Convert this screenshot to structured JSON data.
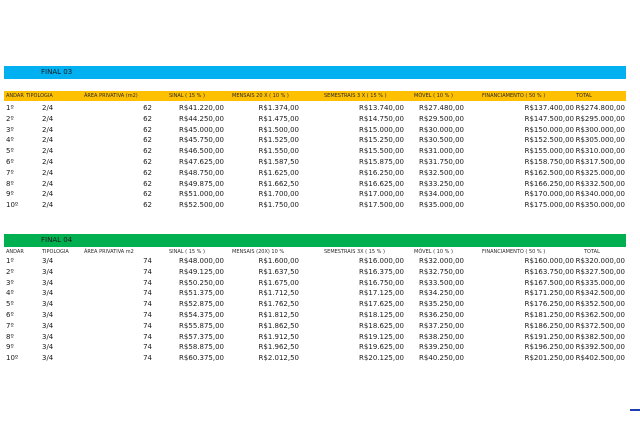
{
  "colors": {
    "band1": "#00b0f0",
    "header1": "#ffc000",
    "band2": "#00b050",
    "header2": "#ffffff",
    "accent": "#1f3fb0"
  },
  "sections": [
    {
      "title": "FINAL 03",
      "headers": [
        "ANDAR",
        "TIPOLOGIA",
        "ÁREA PRIVATIVA (m2)",
        "SINAL ( 15 % )",
        "MENSAIS 20 X ( 10 % )",
        "SEMESTRAIS 3 X ( 15 % )",
        "MÓVEL ( 10 % )",
        "FINANCIAMENTO ( 50 % )",
        "TOTAL"
      ],
      "rows": [
        [
          "1º",
          "2/4",
          "62",
          "R$41.220,00",
          "R$1.374,00",
          "R$13.740,00",
          "R$27.480,00",
          "R$137.400,00",
          "R$274.800,00"
        ],
        [
          "2º",
          "2/4",
          "62",
          "R$44.250,00",
          "R$1.475,00",
          "R$14.750,00",
          "R$29.500,00",
          "R$147.500,00",
          "R$295.000,00"
        ],
        [
          "3º",
          "2/4",
          "62",
          "R$45.000,00",
          "R$1.500,00",
          "R$15.000,00",
          "R$30.000,00",
          "R$150.000,00",
          "R$300.000,00"
        ],
        [
          "4º",
          "2/4",
          "62",
          "R$45.750,00",
          "R$1.525,00",
          "R$15.250,00",
          "R$30.500,00",
          "R$152.500,00",
          "R$305.000,00"
        ],
        [
          "5º",
          "2/4",
          "62",
          "R$46.500,00",
          "R$1.550,00",
          "R$15.500,00",
          "R$31.000,00",
          "R$155.000,00",
          "R$310.000,00"
        ],
        [
          "6º",
          "2/4",
          "62",
          "R$47.625,00",
          "R$1.587,50",
          "R$15.875,00",
          "R$31.750,00",
          "R$158.750,00",
          "R$317.500,00"
        ],
        [
          "7º",
          "2/4",
          "62",
          "R$48.750,00",
          "R$1.625,00",
          "R$16.250,00",
          "R$32.500,00",
          "R$162.500,00",
          "R$325.000,00"
        ],
        [
          "8º",
          "2/4",
          "62",
          "R$49.875,00",
          "R$1.662,50",
          "R$16.625,00",
          "R$33.250,00",
          "R$166.250,00",
          "R$332.500,00"
        ],
        [
          "9º",
          "2/4",
          "62",
          "R$51.000,00",
          "R$1.700,00",
          "R$17.000,00",
          "R$34.000,00",
          "R$170.000,00",
          "R$340.000,00"
        ],
        [
          "10º",
          "2/4",
          "62",
          "R$52.500,00",
          "R$1.750,00",
          "R$17.500,00",
          "R$35.000,00",
          "R$175.000,00",
          "R$350.000,00"
        ]
      ]
    },
    {
      "title": "FINAL 04",
      "headers": [
        "ANDAR",
        "TIPOLOGIA",
        "ÁREA PRIVATIVA m2",
        "SINAL ( 15 % )",
        "MENSAIS (20X) 10 %",
        "SEMESTRAIS 3X ( 15 % )",
        "MÓVEL ( 10 % )",
        "FINANCIAMENTO ( 50 % )",
        "TOTAL"
      ],
      "rows": [
        [
          "1º",
          "3/4",
          "74",
          "R$48.000,00",
          "R$1.600,00",
          "R$16.000,00",
          "R$32.000,00",
          "R$160.000,00",
          "R$320.000,00"
        ],
        [
          "2º",
          "3/4",
          "74",
          "R$49.125,00",
          "R$1.637,50",
          "R$16.375,00",
          "R$32.750,00",
          "R$163.750,00",
          "R$327.500,00"
        ],
        [
          "3º",
          "3/4",
          "74",
          "R$50.250,00",
          "R$1.675,00",
          "R$16.750,00",
          "R$33.500,00",
          "R$167.500,00",
          "R$335.000,00"
        ],
        [
          "4º",
          "3/4",
          "74",
          "R$51.375,00",
          "R$1.712,50",
          "R$17.125,00",
          "R$34.250,00",
          "R$171.250,00",
          "R$342.500,00"
        ],
        [
          "5º",
          "3/4",
          "74",
          "R$52.875,00",
          "R$1.762,50",
          "R$17.625,00",
          "R$35.250,00",
          "R$176.250,00",
          "R$352.500,00"
        ],
        [
          "6º",
          "3/4",
          "74",
          "R$54.375,00",
          "R$1.812,50",
          "R$18.125,00",
          "R$36.250,00",
          "R$181.250,00",
          "R$362.500,00"
        ],
        [
          "7º",
          "3/4",
          "74",
          "R$55.875,00",
          "R$1.862,50",
          "R$18.625,00",
          "R$37.250,00",
          "R$186.250,00",
          "R$372.500,00"
        ],
        [
          "8º",
          "3/4",
          "74",
          "R$57.375,00",
          "R$1.912,50",
          "R$19.125,00",
          "R$38.250,00",
          "R$191.250,00",
          "R$382.500,00"
        ],
        [
          "9º",
          "3/4",
          "74",
          "R$58.875,00",
          "R$1.962,50",
          "R$19.625,00",
          "R$39.250,00",
          "R$196.250,00",
          "R$392.500,00"
        ],
        [
          "10º",
          "3/4",
          "74",
          "R$60.375,00",
          "R$2.012,50",
          "R$20.125,00",
          "R$40.250,00",
          "R$201.250,00",
          "R$402.500,00"
        ]
      ]
    }
  ]
}
